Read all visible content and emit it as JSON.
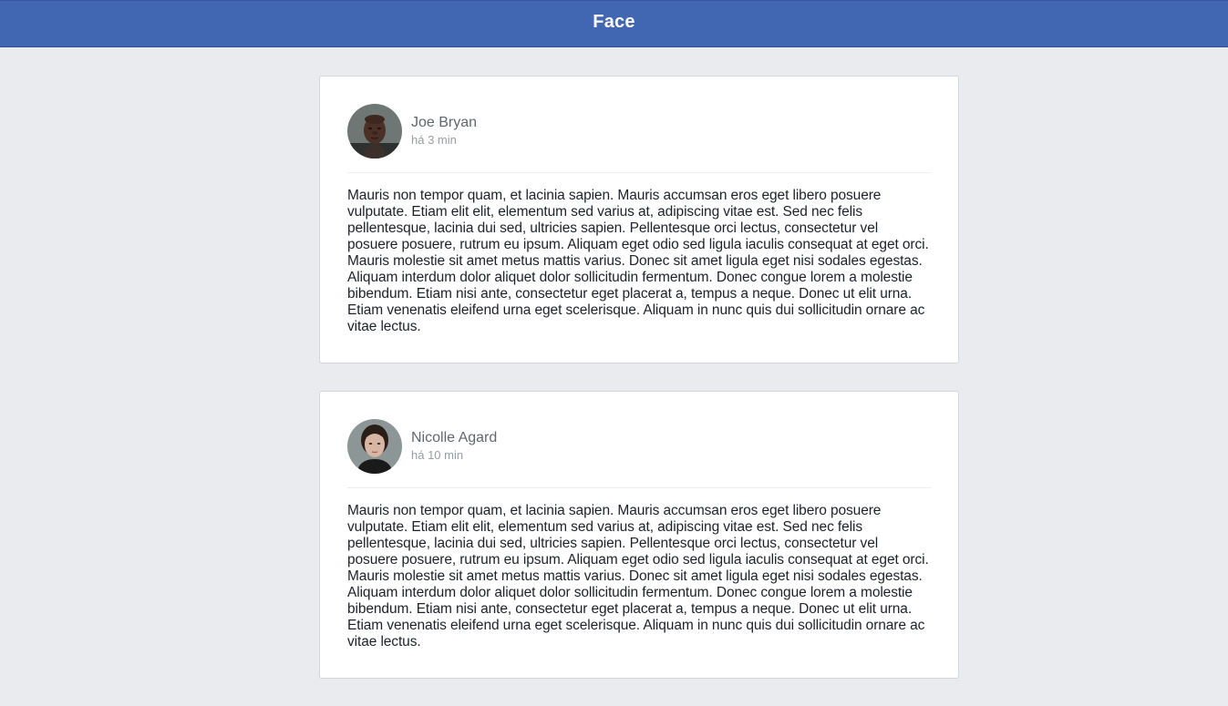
{
  "header": {
    "title": "Face",
    "color": "#4267b2"
  },
  "posts": [
    {
      "author": "Joe Bryan",
      "time": "há 3 min",
      "avatar_icon": "user-avatar-photo",
      "content": "Mauris non tempor quam, et lacinia sapien. Mauris accumsan eros eget libero posuere vulputate. Etiam elit elit, elementum sed varius at, adipiscing vitae est. Sed nec felis pellentesque, lacinia dui sed, ultricies sapien. Pellentesque orci lectus, consectetur vel posuere posuere, rutrum eu ipsum. Aliquam eget odio sed ligula iaculis consequat at eget orci. Mauris molestie sit amet metus mattis varius. Donec sit amet ligula eget nisi sodales egestas. Aliquam interdum dolor aliquet dolor sollicitudin fermentum. Donec congue lorem a molestie bibendum. Etiam nisi ante, consectetur eget placerat a, tempus a neque. Donec ut elit urna. Etiam venenatis eleifend urna eget scelerisque. Aliquam in nunc quis dui sollicitudin ornare ac vitae lectus."
    },
    {
      "author": "Nicolle Agard",
      "time": "há 10 min",
      "avatar_icon": "user-avatar-photo",
      "content": "Mauris non tempor quam, et lacinia sapien. Mauris accumsan eros eget libero posuere vulputate. Etiam elit elit, elementum sed varius at, adipiscing vitae est. Sed nec felis pellentesque, lacinia dui sed, ultricies sapien. Pellentesque orci lectus, consectetur vel posuere posuere, rutrum eu ipsum. Aliquam eget odio sed ligula iaculis consequat at eget orci. Mauris molestie sit amet metus mattis varius. Donec sit amet ligula eget nisi sodales egestas. Aliquam interdum dolor aliquet dolor sollicitudin fermentum. Donec congue lorem a molestie bibendum. Etiam nisi ante, consectetur eget placerat a, tempus a neque. Donec ut elit urna. Etiam venenatis eleifend urna eget scelerisque. Aliquam in nunc quis dui sollicitudin ornare ac vitae lectus."
    }
  ]
}
